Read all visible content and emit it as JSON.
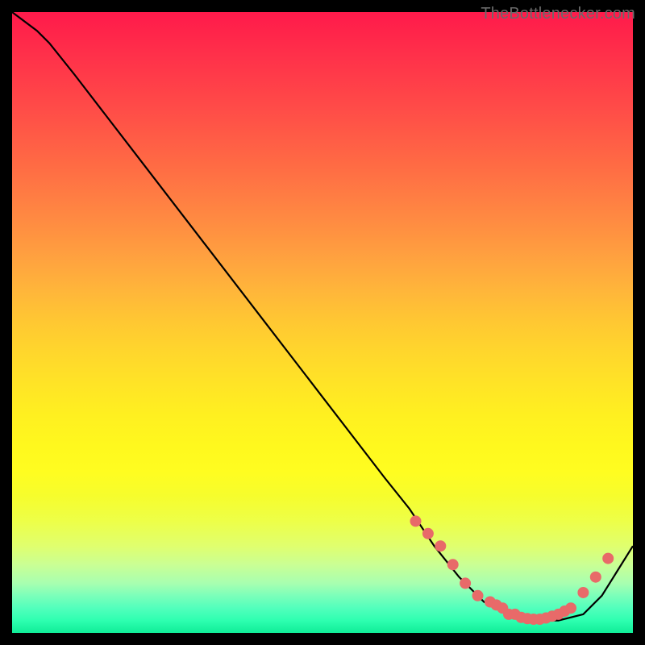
{
  "watermark": "TheBottlenecker.com",
  "colors": {
    "bg": "#000000",
    "watermark_text": "#6a6a6a",
    "line_stroke": "#000000",
    "marker_fill": "#e86a69",
    "marker_stroke": "#e86a69",
    "gradient": [
      {
        "offset": 0.0,
        "color": "#ff1a4b"
      },
      {
        "offset": 0.05,
        "color": "#ff2a4a"
      },
      {
        "offset": 0.1,
        "color": "#ff3a49"
      },
      {
        "offset": 0.15,
        "color": "#ff4a48"
      },
      {
        "offset": 0.2,
        "color": "#ff5b46"
      },
      {
        "offset": 0.25,
        "color": "#ff6c44"
      },
      {
        "offset": 0.3,
        "color": "#ff7e43"
      },
      {
        "offset": 0.35,
        "color": "#ff9041"
      },
      {
        "offset": 0.4,
        "color": "#ffa33f"
      },
      {
        "offset": 0.45,
        "color": "#ffb63a"
      },
      {
        "offset": 0.5,
        "color": "#ffc832"
      },
      {
        "offset": 0.55,
        "color": "#ffd72c"
      },
      {
        "offset": 0.6,
        "color": "#ffe426"
      },
      {
        "offset": 0.65,
        "color": "#fff020"
      },
      {
        "offset": 0.7,
        "color": "#fff81e"
      },
      {
        "offset": 0.74,
        "color": "#fffd20"
      },
      {
        "offset": 0.78,
        "color": "#f6fd2d"
      },
      {
        "offset": 0.82,
        "color": "#edff48"
      },
      {
        "offset": 0.86,
        "color": "#e0ff6e"
      },
      {
        "offset": 0.89,
        "color": "#caff94"
      },
      {
        "offset": 0.92,
        "color": "#a8ffb0"
      },
      {
        "offset": 0.94,
        "color": "#7bffba"
      },
      {
        "offset": 0.96,
        "color": "#52ffbc"
      },
      {
        "offset": 0.98,
        "color": "#2effb0"
      },
      {
        "offset": 1.0,
        "color": "#10ed98"
      }
    ]
  },
  "chart_data": {
    "type": "line",
    "title": "",
    "xlabel": "",
    "ylabel": "",
    "xlim": [
      0,
      100
    ],
    "ylim": [
      0,
      100
    ],
    "x": [
      0,
      4,
      6,
      10,
      20,
      30,
      40,
      50,
      60,
      64,
      68,
      72,
      76,
      80,
      84,
      88,
      92,
      95,
      100
    ],
    "y": [
      100,
      97,
      95,
      90,
      77,
      64,
      51,
      38,
      25,
      20,
      14,
      9,
      5,
      3,
      2,
      2,
      3,
      6,
      14
    ],
    "markers": {
      "x": [
        65,
        67,
        69,
        71,
        73,
        75,
        77,
        78,
        79,
        80,
        81,
        82,
        83,
        84,
        85,
        86,
        87,
        88,
        89,
        90,
        92,
        94,
        96
      ],
      "y": [
        18,
        16,
        14,
        11,
        8,
        6,
        5,
        4.5,
        4,
        3,
        3,
        2.5,
        2.3,
        2.2,
        2.2,
        2.4,
        2.7,
        3.0,
        3.5,
        4.0,
        6.5,
        9.0,
        12
      ]
    }
  }
}
